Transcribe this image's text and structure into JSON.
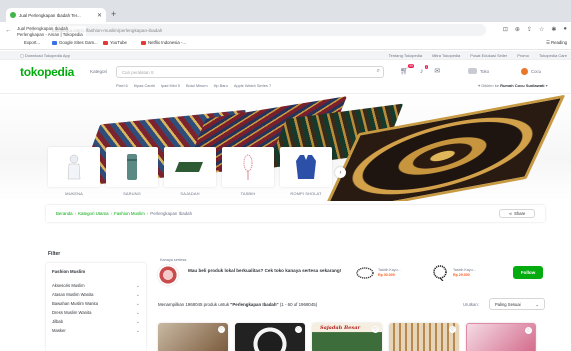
{
  "browser": {
    "tab_title": "Jual Perlengkapan Ibadah Ter...",
    "tab_close": "✕",
    "new_tab": "+",
    "url_host": "tokopedia.com",
    "url_path": "/p/fashion-muslim/perlengkapan-ibadah",
    "autocomplete_title": "Jual Perlengkapan Ibadah",
    "autocomplete_sub": "Perlengkapan - Aman | Tokopedia",
    "bookmarks": [
      "Export...",
      "Google Sites Gam...",
      "YouTube",
      "Netflix Indonesia -..."
    ],
    "reading_list": "Reading"
  },
  "promo_bar": {
    "download": "Download Tokopedia App",
    "links": [
      "Tentang Tokopedia",
      "Mitra Tokopedia",
      "Pusat Edukasi Seller",
      "Promo",
      "Tokopedia Care"
    ]
  },
  "header": {
    "logo": "tokopedia",
    "kategori": "Kategori",
    "search_placeholder": "Cari peralatan S",
    "cart_badge": "99",
    "notif_badge": "1",
    "toko": "Toko",
    "user": "Cocu",
    "suggestions": [
      "Pixel 6",
      "Kipas Cantri",
      "Ipad Mini 5",
      "Botol Minum",
      "Hp Baru",
      "Apple Watch Series 7"
    ],
    "deliver_label": "Dikirim ke",
    "deliver_addr": "Rumah Cocu Sudiawati"
  },
  "categories": [
    {
      "label": "MUKENA",
      "icon": "mukena-icon"
    },
    {
      "label": "SARUNG",
      "icon": "sarung-icon"
    },
    {
      "label": "SAJADAH",
      "icon": "sajadah-icon"
    },
    {
      "label": "TASBIH",
      "icon": "tasbih-icon"
    },
    {
      "label": "ROMPI SHOLAT",
      "icon": "rompi-icon"
    }
  ],
  "breadcrumb": {
    "items": [
      "Beranda",
      "Kategori Utama",
      "Fashion Muslim"
    ],
    "current": "Perlengkapan Ibadah",
    "share": "Share"
  },
  "filter": {
    "heading": "Filter",
    "group": "Fashion Muslim",
    "items": [
      "Aksesoris Muslim",
      "Atasan Muslim Wanita",
      "Bawahan Muslim Wanita",
      "Dress Muslim Wanita",
      "Jilbab",
      "Masker"
    ]
  },
  "shop": {
    "tagline": "Kanaya sertesa",
    "message": "Mau beli produk lokal berkualitas? Cek toko kanaya sertesa sekarang!",
    "products": [
      {
        "name": "Tasbih Kayu...",
        "price": "Rp 30.000"
      },
      {
        "name": "Tasbih Kayu...",
        "price": "Rp 29.000"
      }
    ],
    "follow": "Follow"
  },
  "results": {
    "prefix": "Menampilkan 1968045 produk untuk",
    "query": "\"Perlengkapan Ibadah\"",
    "range": "(1 - 60 of 1968045)",
    "sort_label": "Urutkan:",
    "sort_value": "Paling Sesuai"
  },
  "product_cards": [
    {
      "caption": ""
    },
    {
      "caption": ""
    },
    {
      "caption": "Sajadah Besar"
    },
    {
      "caption": ""
    },
    {
      "caption": ""
    }
  ],
  "colors": {
    "brand": "#03ac0e",
    "badge": "#ef144a",
    "price": "#fa591d"
  }
}
